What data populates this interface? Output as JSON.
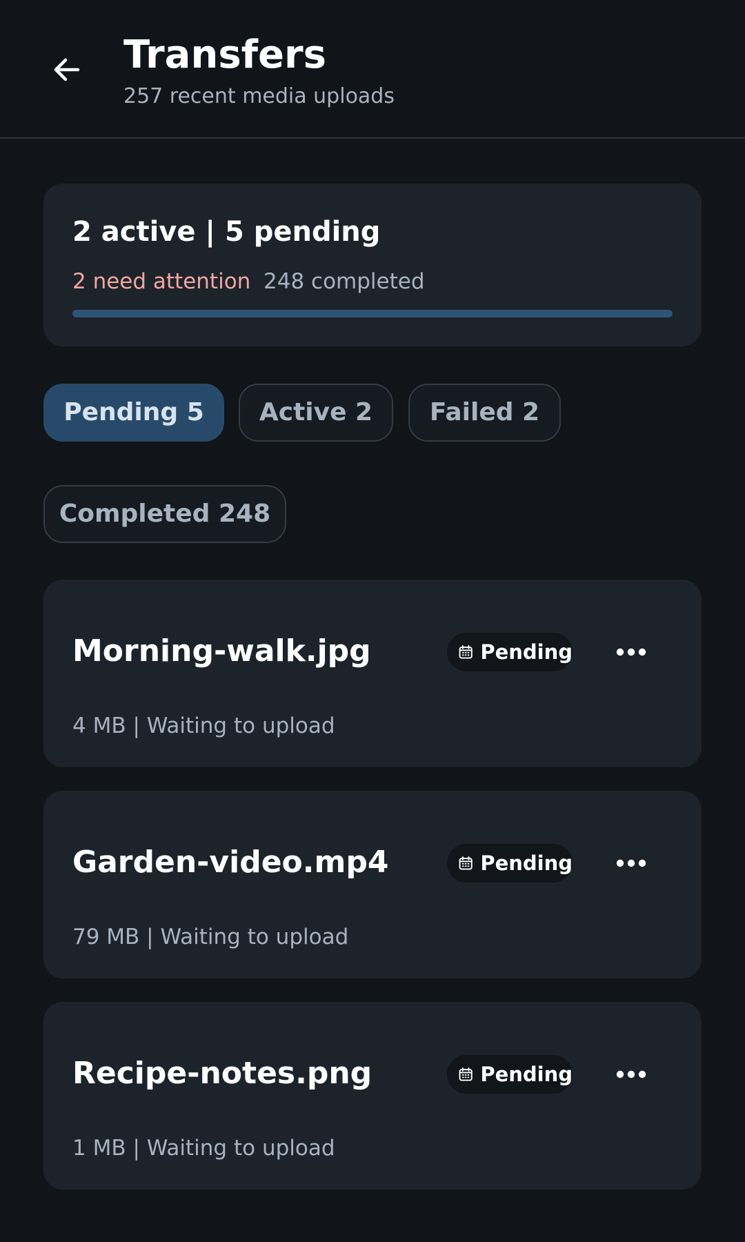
{
  "header": {
    "back_icon": "arrow-left-icon",
    "title": "Transfers",
    "subtitle": "257 recent media uploads"
  },
  "summary": {
    "title": "2 active | 5 pending",
    "attention": "2 need attention",
    "completed": "248 completed",
    "progress_fraction": 1.0,
    "attention_color": "#f3a6a0",
    "progress_color": "#2e5475"
  },
  "filters": [
    {
      "label": "Pending 5",
      "selected": true
    },
    {
      "label": "Active 2",
      "selected": false
    },
    {
      "label": "Failed 2",
      "selected": false
    },
    {
      "label": "Completed 248",
      "selected": false
    }
  ],
  "files": [
    {
      "name": "Morning-walk.jpg",
      "status": "Pending",
      "status_icon": "calendar-icon",
      "more_icon": "more-horizontal-icon",
      "meta": "4 MB | Waiting to upload"
    },
    {
      "name": "Garden-video.mp4",
      "status": "Pending",
      "status_icon": "calendar-icon",
      "more_icon": "more-horizontal-icon",
      "meta": "79 MB | Waiting to upload"
    },
    {
      "name": "Recipe-notes.png",
      "status": "Pending",
      "status_icon": "calendar-icon",
      "more_icon": "more-horizontal-icon",
      "meta": "1 MB | Waiting to upload"
    }
  ],
  "colors": {
    "background": "#111418",
    "card": "#1d232b",
    "selected_chip": "#274a6a",
    "muted_text": "#a7b3c0"
  }
}
